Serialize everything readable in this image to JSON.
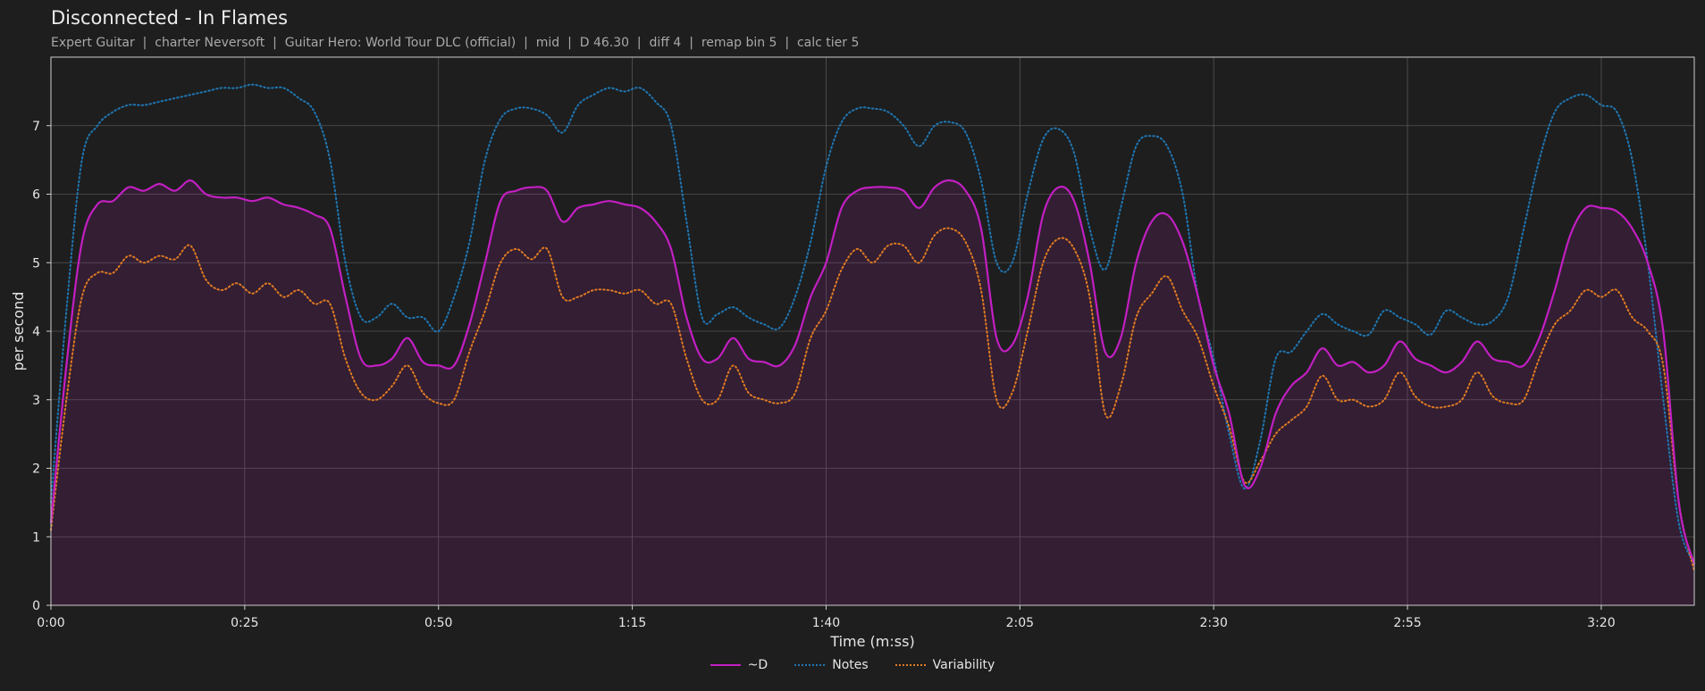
{
  "title": "Disconnected - In Flames",
  "subtitle": "Expert Guitar  |  charter Neversoft  |  Guitar Hero: World Tour DLC (official)  |  mid  |  D 46.30  |  diff 4  |  remap bin 5  |  calc tier 5",
  "colors": {
    "D": "#c21fc2",
    "notes": "#1f77b4",
    "variability": "#e07b22"
  },
  "chart_data": {
    "type": "line",
    "xlabel": "Time (m:ss)",
    "ylabel": "per second",
    "xlim": [
      0,
      212
    ],
    "ylim": [
      0,
      8
    ],
    "x_ticks": [
      0,
      25,
      50,
      75,
      100,
      125,
      150,
      175,
      200
    ],
    "x_tick_labels": [
      "0:00",
      "0:25",
      "0:50",
      "1:15",
      "1:40",
      "2:05",
      "2:30",
      "2:55",
      "3:20"
    ],
    "y_ticks": [
      0,
      1,
      2,
      3,
      4,
      5,
      6,
      7
    ],
    "y_tick_labels": [
      "0",
      "1",
      "2",
      "3",
      "4",
      "5",
      "6",
      "7"
    ],
    "grid": true,
    "legend_position": "bottom-center",
    "series": [
      {
        "name": "~D",
        "style": "solid",
        "fill": true,
        "points": [
          [
            0,
            1.2
          ],
          [
            2,
            3.5
          ],
          [
            4,
            5.3
          ],
          [
            6,
            5.85
          ],
          [
            8,
            5.9
          ],
          [
            10,
            6.1
          ],
          [
            12,
            6.05
          ],
          [
            14,
            6.15
          ],
          [
            16,
            6.05
          ],
          [
            18,
            6.2
          ],
          [
            20,
            6.0
          ],
          [
            22,
            5.95
          ],
          [
            24,
            5.95
          ],
          [
            26,
            5.9
          ],
          [
            28,
            5.95
          ],
          [
            30,
            5.85
          ],
          [
            32,
            5.8
          ],
          [
            34,
            5.7
          ],
          [
            36,
            5.5
          ],
          [
            38,
            4.5
          ],
          [
            40,
            3.6
          ],
          [
            42,
            3.5
          ],
          [
            44,
            3.6
          ],
          [
            46,
            3.9
          ],
          [
            48,
            3.55
          ],
          [
            50,
            3.5
          ],
          [
            52,
            3.5
          ],
          [
            54,
            4.1
          ],
          [
            56,
            5.0
          ],
          [
            58,
            5.9
          ],
          [
            60,
            6.05
          ],
          [
            62,
            6.1
          ],
          [
            64,
            6.05
          ],
          [
            66,
            5.6
          ],
          [
            68,
            5.8
          ],
          [
            70,
            5.85
          ],
          [
            72,
            5.9
          ],
          [
            74,
            5.85
          ],
          [
            76,
            5.8
          ],
          [
            78,
            5.6
          ],
          [
            80,
            5.2
          ],
          [
            82,
            4.2
          ],
          [
            84,
            3.6
          ],
          [
            86,
            3.6
          ],
          [
            88,
            3.9
          ],
          [
            90,
            3.6
          ],
          [
            92,
            3.55
          ],
          [
            94,
            3.5
          ],
          [
            96,
            3.8
          ],
          [
            98,
            4.5
          ],
          [
            100,
            5.0
          ],
          [
            102,
            5.8
          ],
          [
            104,
            6.05
          ],
          [
            106,
            6.1
          ],
          [
            108,
            6.1
          ],
          [
            110,
            6.05
          ],
          [
            112,
            5.8
          ],
          [
            114,
            6.1
          ],
          [
            116,
            6.2
          ],
          [
            118,
            6.05
          ],
          [
            120,
            5.5
          ],
          [
            122,
            3.9
          ],
          [
            124,
            3.8
          ],
          [
            126,
            4.5
          ],
          [
            128,
            5.7
          ],
          [
            130,
            6.1
          ],
          [
            132,
            5.9
          ],
          [
            134,
            5.0
          ],
          [
            136,
            3.7
          ],
          [
            138,
            3.9
          ],
          [
            140,
            5.0
          ],
          [
            142,
            5.6
          ],
          [
            144,
            5.7
          ],
          [
            146,
            5.3
          ],
          [
            148,
            4.5
          ],
          [
            150,
            3.5
          ],
          [
            152,
            2.8
          ],
          [
            154,
            1.75
          ],
          [
            156,
            2.0
          ],
          [
            158,
            2.8
          ],
          [
            160,
            3.2
          ],
          [
            162,
            3.4
          ],
          [
            164,
            3.75
          ],
          [
            166,
            3.5
          ],
          [
            168,
            3.55
          ],
          [
            170,
            3.4
          ],
          [
            172,
            3.5
          ],
          [
            174,
            3.85
          ],
          [
            176,
            3.6
          ],
          [
            178,
            3.5
          ],
          [
            180,
            3.4
          ],
          [
            182,
            3.55
          ],
          [
            184,
            3.85
          ],
          [
            186,
            3.6
          ],
          [
            188,
            3.55
          ],
          [
            190,
            3.5
          ],
          [
            192,
            3.9
          ],
          [
            194,
            4.6
          ],
          [
            196,
            5.4
          ],
          [
            198,
            5.8
          ],
          [
            200,
            5.8
          ],
          [
            202,
            5.75
          ],
          [
            204,
            5.5
          ],
          [
            206,
            5.0
          ],
          [
            208,
            4.0
          ],
          [
            210,
            1.5
          ],
          [
            212,
            0.6
          ]
        ]
      },
      {
        "name": "Notes",
        "style": "dotted",
        "fill": false,
        "points": [
          [
            0,
            1.5
          ],
          [
            2,
            4.3
          ],
          [
            4,
            6.5
          ],
          [
            6,
            7.0
          ],
          [
            8,
            7.2
          ],
          [
            10,
            7.3
          ],
          [
            12,
            7.3
          ],
          [
            14,
            7.35
          ],
          [
            16,
            7.4
          ],
          [
            18,
            7.45
          ],
          [
            20,
            7.5
          ],
          [
            22,
            7.55
          ],
          [
            24,
            7.55
          ],
          [
            26,
            7.6
          ],
          [
            28,
            7.55
          ],
          [
            30,
            7.55
          ],
          [
            32,
            7.4
          ],
          [
            34,
            7.2
          ],
          [
            36,
            6.5
          ],
          [
            38,
            5.0
          ],
          [
            40,
            4.2
          ],
          [
            42,
            4.2
          ],
          [
            44,
            4.4
          ],
          [
            46,
            4.2
          ],
          [
            48,
            4.2
          ],
          [
            50,
            4.0
          ],
          [
            52,
            4.5
          ],
          [
            54,
            5.3
          ],
          [
            56,
            6.5
          ],
          [
            58,
            7.1
          ],
          [
            60,
            7.25
          ],
          [
            62,
            7.25
          ],
          [
            64,
            7.15
          ],
          [
            66,
            6.9
          ],
          [
            68,
            7.3
          ],
          [
            70,
            7.45
          ],
          [
            72,
            7.55
          ],
          [
            74,
            7.5
          ],
          [
            76,
            7.55
          ],
          [
            78,
            7.35
          ],
          [
            80,
            7.0
          ],
          [
            82,
            5.6
          ],
          [
            84,
            4.2
          ],
          [
            86,
            4.25
          ],
          [
            88,
            4.35
          ],
          [
            90,
            4.2
          ],
          [
            92,
            4.1
          ],
          [
            94,
            4.05
          ],
          [
            96,
            4.5
          ],
          [
            98,
            5.3
          ],
          [
            100,
            6.4
          ],
          [
            102,
            7.05
          ],
          [
            104,
            7.25
          ],
          [
            106,
            7.25
          ],
          [
            108,
            7.2
          ],
          [
            110,
            7.0
          ],
          [
            112,
            6.7
          ],
          [
            114,
            7.0
          ],
          [
            116,
            7.05
          ],
          [
            118,
            6.9
          ],
          [
            120,
            6.2
          ],
          [
            122,
            5.0
          ],
          [
            124,
            5.0
          ],
          [
            126,
            6.0
          ],
          [
            128,
            6.8
          ],
          [
            130,
            6.95
          ],
          [
            132,
            6.6
          ],
          [
            134,
            5.5
          ],
          [
            136,
            4.9
          ],
          [
            138,
            5.8
          ],
          [
            140,
            6.7
          ],
          [
            142,
            6.85
          ],
          [
            144,
            6.7
          ],
          [
            146,
            6.0
          ],
          [
            148,
            4.5
          ],
          [
            150,
            3.6
          ],
          [
            152,
            2.5
          ],
          [
            154,
            1.7
          ],
          [
            156,
            2.4
          ],
          [
            158,
            3.6
          ],
          [
            160,
            3.7
          ],
          [
            162,
            4.0
          ],
          [
            164,
            4.25
          ],
          [
            166,
            4.1
          ],
          [
            168,
            4.0
          ],
          [
            170,
            3.95
          ],
          [
            172,
            4.3
          ],
          [
            174,
            4.2
          ],
          [
            176,
            4.1
          ],
          [
            178,
            3.95
          ],
          [
            180,
            4.3
          ],
          [
            182,
            4.2
          ],
          [
            184,
            4.1
          ],
          [
            186,
            4.15
          ],
          [
            188,
            4.5
          ],
          [
            190,
            5.5
          ],
          [
            192,
            6.5
          ],
          [
            194,
            7.2
          ],
          [
            196,
            7.4
          ],
          [
            198,
            7.45
          ],
          [
            200,
            7.3
          ],
          [
            202,
            7.2
          ],
          [
            204,
            6.5
          ],
          [
            206,
            5.0
          ],
          [
            208,
            3.0
          ],
          [
            210,
            1.2
          ],
          [
            212,
            0.6
          ]
        ]
      },
      {
        "name": "Variability",
        "style": "dotted",
        "fill": false,
        "points": [
          [
            0,
            1.1
          ],
          [
            2,
            3.0
          ],
          [
            4,
            4.5
          ],
          [
            6,
            4.85
          ],
          [
            8,
            4.85
          ],
          [
            10,
            5.1
          ],
          [
            12,
            5.0
          ],
          [
            14,
            5.1
          ],
          [
            16,
            5.05
          ],
          [
            18,
            5.25
          ],
          [
            20,
            4.75
          ],
          [
            22,
            4.6
          ],
          [
            24,
            4.7
          ],
          [
            26,
            4.55
          ],
          [
            28,
            4.7
          ],
          [
            30,
            4.5
          ],
          [
            32,
            4.6
          ],
          [
            34,
            4.4
          ],
          [
            36,
            4.4
          ],
          [
            38,
            3.6
          ],
          [
            40,
            3.1
          ],
          [
            42,
            3.0
          ],
          [
            44,
            3.2
          ],
          [
            46,
            3.5
          ],
          [
            48,
            3.1
          ],
          [
            50,
            2.95
          ],
          [
            52,
            3.0
          ],
          [
            54,
            3.7
          ],
          [
            56,
            4.3
          ],
          [
            58,
            5.0
          ],
          [
            60,
            5.2
          ],
          [
            62,
            5.05
          ],
          [
            64,
            5.2
          ],
          [
            66,
            4.5
          ],
          [
            68,
            4.5
          ],
          [
            70,
            4.6
          ],
          [
            72,
            4.6
          ],
          [
            74,
            4.55
          ],
          [
            76,
            4.6
          ],
          [
            78,
            4.4
          ],
          [
            80,
            4.4
          ],
          [
            82,
            3.6
          ],
          [
            84,
            3.0
          ],
          [
            86,
            3.0
          ],
          [
            88,
            3.5
          ],
          [
            90,
            3.1
          ],
          [
            92,
            3.0
          ],
          [
            94,
            2.95
          ],
          [
            96,
            3.1
          ],
          [
            98,
            3.9
          ],
          [
            100,
            4.3
          ],
          [
            102,
            4.9
          ],
          [
            104,
            5.2
          ],
          [
            106,
            5.0
          ],
          [
            108,
            5.25
          ],
          [
            110,
            5.25
          ],
          [
            112,
            5.0
          ],
          [
            114,
            5.4
          ],
          [
            116,
            5.5
          ],
          [
            118,
            5.3
          ],
          [
            120,
            4.6
          ],
          [
            122,
            3.0
          ],
          [
            124,
            3.1
          ],
          [
            126,
            4.0
          ],
          [
            128,
            5.0
          ],
          [
            130,
            5.35
          ],
          [
            132,
            5.2
          ],
          [
            134,
            4.5
          ],
          [
            136,
            2.8
          ],
          [
            138,
            3.2
          ],
          [
            140,
            4.2
          ],
          [
            142,
            4.55
          ],
          [
            144,
            4.8
          ],
          [
            146,
            4.3
          ],
          [
            148,
            3.9
          ],
          [
            150,
            3.2
          ],
          [
            152,
            2.6
          ],
          [
            154,
            1.8
          ],
          [
            156,
            2.1
          ],
          [
            158,
            2.5
          ],
          [
            160,
            2.7
          ],
          [
            162,
            2.9
          ],
          [
            164,
            3.35
          ],
          [
            166,
            3.0
          ],
          [
            168,
            3.0
          ],
          [
            170,
            2.9
          ],
          [
            172,
            3.0
          ],
          [
            174,
            3.4
          ],
          [
            176,
            3.05
          ],
          [
            178,
            2.9
          ],
          [
            180,
            2.9
          ],
          [
            182,
            3.0
          ],
          [
            184,
            3.4
          ],
          [
            186,
            3.05
          ],
          [
            188,
            2.95
          ],
          [
            190,
            3.0
          ],
          [
            192,
            3.6
          ],
          [
            194,
            4.1
          ],
          [
            196,
            4.3
          ],
          [
            198,
            4.6
          ],
          [
            200,
            4.5
          ],
          [
            202,
            4.6
          ],
          [
            204,
            4.2
          ],
          [
            206,
            4.0
          ],
          [
            208,
            3.5
          ],
          [
            210,
            1.5
          ],
          [
            212,
            0.5
          ]
        ]
      }
    ]
  }
}
